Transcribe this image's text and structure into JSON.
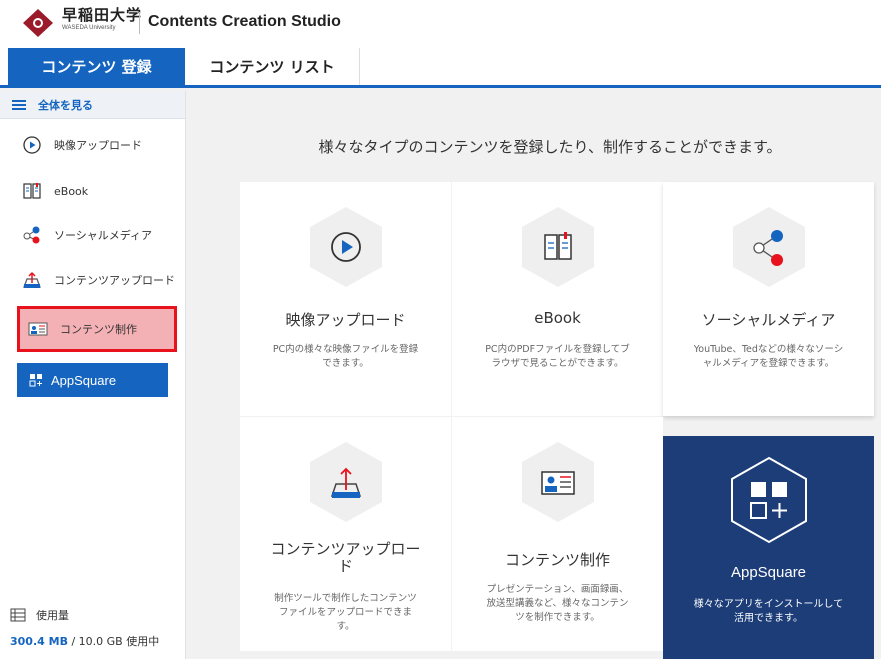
{
  "header": {
    "logo_jp": "早稲田大学",
    "logo_en": "WASEDA University",
    "app_title": "Contents Creation Studio"
  },
  "tabs": [
    {
      "label": "コンテンツ 登録",
      "active": true
    },
    {
      "label": "コンテンツ リスト",
      "active": false
    }
  ],
  "sidebar": {
    "see_all": "全体を見る",
    "items": [
      {
        "label": "映像アップロード",
        "icon": "play-circle-icon"
      },
      {
        "label": "eBook",
        "icon": "ebook-icon"
      },
      {
        "label": "ソーシャルメディア",
        "icon": "share-icon"
      },
      {
        "label": "コンテンツアップロード",
        "icon": "upload-tray-icon"
      },
      {
        "label": "コンテンツ制作",
        "icon": "content-card-icon",
        "selected": true
      }
    ],
    "appsquare_label": "AppSquare",
    "usage_label": "使用量",
    "usage_used": "300.4 MB",
    "usage_rest": " / 10.0 GB 使用中"
  },
  "main": {
    "headline": "様々なタイプのコンテンツを登録したり、制作することができます。",
    "cards": [
      {
        "title": "映像アップロード",
        "desc": "PC内の様々な映像ファイルを登録できます。"
      },
      {
        "title": "eBook",
        "desc": "PC内のPDFファイルを登録してブラウザで見ることができます。"
      },
      {
        "title": "ソーシャルメディア",
        "desc": "YouTube、Tedなどの様々なソーシャルメディアを登録できます。"
      },
      {
        "title": "コンテンツアップロード",
        "desc": "制作ツールで制作したコンテンツファイルをアップロードできます。"
      },
      {
        "title": "コンテンツ制作",
        "desc": "プレゼンテーション、画面録画、放送型講義など、様々なコンテンツを制作できます。"
      },
      {
        "title": "AppSquare",
        "desc": "様々なアプリをインストールして活用できます。"
      }
    ]
  },
  "colors": {
    "accent": "#1565c0",
    "selected_bg": "#f4b1b5",
    "selected_border": "#e8121c",
    "dark_card": "#1c3d78"
  }
}
